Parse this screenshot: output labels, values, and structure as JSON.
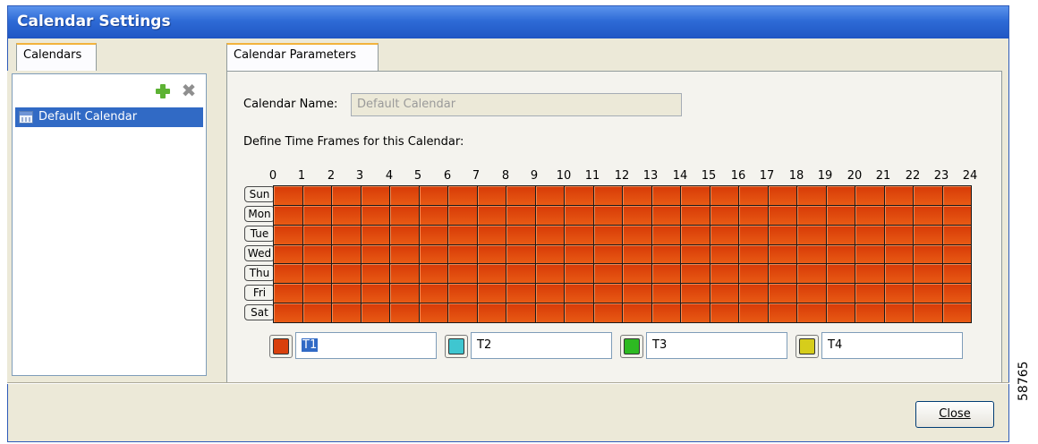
{
  "window": {
    "title": "Calendar Settings"
  },
  "left_panel": {
    "tab_label": "Calendars",
    "toolbar": {
      "add_icon": "plus-icon",
      "remove_icon": "x-icon"
    },
    "items": [
      {
        "label": "Default Calendar",
        "icon": "calendar-icon",
        "selected": true
      }
    ]
  },
  "right_panel": {
    "tab_label": "Calendar Parameters",
    "name_label": "Calendar Name:",
    "name_placeholder": "Default Calendar",
    "define_label": "Define Time Frames for this Calendar:",
    "hours": [
      "0",
      "1",
      "2",
      "3",
      "4",
      "5",
      "6",
      "7",
      "8",
      "9",
      "10",
      "11",
      "12",
      "13",
      "14",
      "15",
      "16",
      "17",
      "18",
      "19",
      "20",
      "21",
      "22",
      "23",
      "24"
    ],
    "days": [
      "Sun",
      "Mon",
      "Tue",
      "Wed",
      "Thu",
      "Fri",
      "Sat"
    ],
    "time_frames": [
      {
        "name": "T1",
        "color": "#d9400c",
        "selected": true
      },
      {
        "name": "T2",
        "color": "#3fc6d0",
        "selected": false
      },
      {
        "name": "T3",
        "color": "#2dba22",
        "selected": false
      },
      {
        "name": "T4",
        "color": "#d6cd1b",
        "selected": false
      }
    ],
    "grid_assignment": "T1"
  },
  "footer": {
    "close_label": "Close"
  },
  "side_label": "58765"
}
